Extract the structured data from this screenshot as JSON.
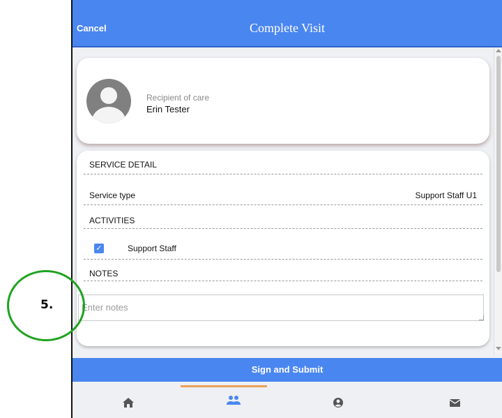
{
  "header": {
    "cancel_label": "Cancel",
    "title": "Complete Visit"
  },
  "recipient": {
    "label": "Recipient of care",
    "name": "Erin Tester"
  },
  "service_detail": {
    "section_label": "SERVICE DETAIL",
    "service_type_label": "Service type",
    "service_type_value": "Support Staff U1"
  },
  "activities": {
    "section_label": "ACTIVITIES",
    "items": [
      {
        "label": "Support Staff",
        "checked": true
      }
    ]
  },
  "notes": {
    "section_label": "NOTES",
    "placeholder": "Enter notes"
  },
  "submit_label": "Sign and Submit",
  "bottom_nav": {
    "items": [
      "home-icon",
      "people-icon",
      "account-icon",
      "mail-icon"
    ],
    "active": "people-icon"
  },
  "callout": {
    "label": "5."
  },
  "colors": {
    "primary": "#4a86f0",
    "active_indicator": "#e8a25a",
    "callout_ring": "#1ea31e"
  }
}
